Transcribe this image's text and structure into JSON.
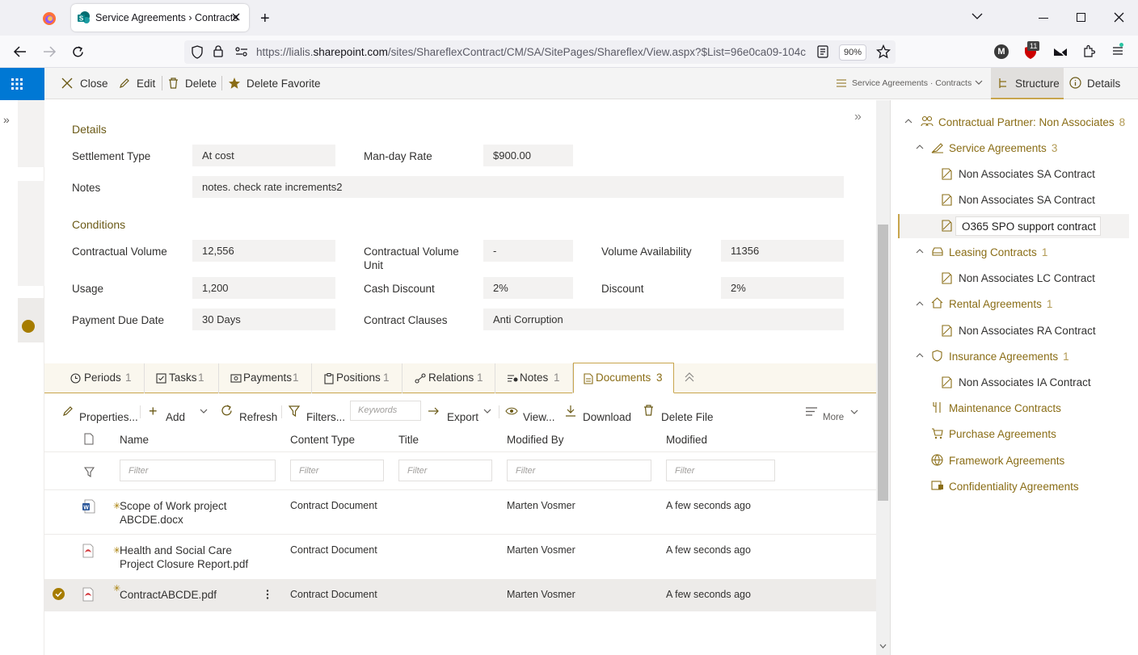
{
  "browser": {
    "tab_title": "Service Agreements › Contracts",
    "new_tab": "+",
    "url_prefix": "https://lialis.",
    "url_domain": "sharepoint.com",
    "url_rest": "/sites/ShareflexContract/CM/SA/SitePages/Shareflex/View.aspx?$List=96e0ca09-104c",
    "zoom": "90%",
    "badge_count": "11",
    "account_initial": "M"
  },
  "commandbar": {
    "close": "Close",
    "edit": "Edit",
    "delete": "Delete",
    "delete_favorite": "Delete Favorite",
    "breadcrumb": "Service Agreements · Contracts",
    "structure": "Structure",
    "details": "Details"
  },
  "form": {
    "details_title": "Details",
    "settlement_type_label": "Settlement Type",
    "settlement_type_value": "At cost",
    "man_day_rate_label": "Man-day Rate",
    "man_day_rate_value": "$900.00",
    "notes_label": "Notes",
    "notes_value": "notes. check rate increments2",
    "conditions_title": "Conditions",
    "contractual_volume_label": "Contractual Volume",
    "contractual_volume_value": "12,556",
    "contractual_volume_unit_label_1": "Contractual Volume",
    "contractual_volume_unit_label_2": "Unit",
    "contractual_volume_unit_value": "-",
    "volume_availability_label": "Volume Availability",
    "volume_availability_value": "11356",
    "usage_label": "Usage",
    "usage_value": "1,200",
    "cash_discount_label": "Cash Discount",
    "cash_discount_value": "2%",
    "discount_label": "Discount",
    "discount_value": "2%",
    "payment_due_date_label": "Payment Due Date",
    "payment_due_date_value": "30 Days",
    "contract_clauses_label": "Contract Clauses",
    "contract_clauses_value": "Anti Corruption"
  },
  "tabs": [
    {
      "label": "Periods",
      "count": "1"
    },
    {
      "label": "Tasks",
      "count": "1"
    },
    {
      "label": "Payments",
      "count": "1"
    },
    {
      "label": "Positions",
      "count": "1"
    },
    {
      "label": "Relations",
      "count": "1"
    },
    {
      "label": "Notes",
      "count": "1"
    },
    {
      "label": "Documents",
      "count": "3"
    }
  ],
  "doc_toolbar": {
    "properties": "Properties...",
    "add": "Add",
    "refresh": "Refresh",
    "filters": "Filters...",
    "keywords_placeholder": "Keywords",
    "export": "Export",
    "view": "View...",
    "download": "Download",
    "delete_file": "Delete File",
    "more": "More"
  },
  "doc_table": {
    "headers": {
      "name": "Name",
      "content_type": "Content Type",
      "title": "Title",
      "modified_by": "Modified By",
      "modified": "Modified"
    },
    "filter_placeholder": "Filter",
    "rows": [
      {
        "name_1": "Scope of Work project",
        "name_2": "ABCDE.docx",
        "content_type": "Contract Document",
        "modified_by": "Marten Vosmer",
        "modified": "A few seconds ago"
      },
      {
        "name_1": "Health and Social Care",
        "name_2": "Project Closure Report.pdf",
        "content_type": "Contract Document",
        "modified_by": "Marten Vosmer",
        "modified": "A few seconds ago"
      },
      {
        "name_1": "ContractABCDE.pdf",
        "name_2": "",
        "content_type": "Contract Document",
        "modified_by": "Marten Vosmer",
        "modified": "A few seconds ago"
      }
    ]
  },
  "tree": {
    "root": {
      "label": "Contractual Partner: Non Associates",
      "count": "8"
    },
    "service": {
      "label": "Service Agreements",
      "count": "3"
    },
    "service_items": [
      "Non Associates SA Contract",
      "Non Associates SA Contract",
      "O365 SPO support contract"
    ],
    "leasing": {
      "label": "Leasing Contracts",
      "count": "1"
    },
    "leasing_item": "Non Associates LC Contract",
    "rental": {
      "label": "Rental Agreements",
      "count": "1"
    },
    "rental_item": "Non Associates RA Contract",
    "insurance": {
      "label": "Insurance Agreements",
      "count": "1"
    },
    "insurance_item": "Non Associates IA Contract",
    "maintenance": "Maintenance Contracts",
    "purchase": "Purchase Agreements",
    "framework": "Framework Agreements",
    "confidentiality": "Confidentiality Agreements"
  },
  "colors": {
    "accent": "#8a6d16",
    "brand": "#0078d4"
  }
}
